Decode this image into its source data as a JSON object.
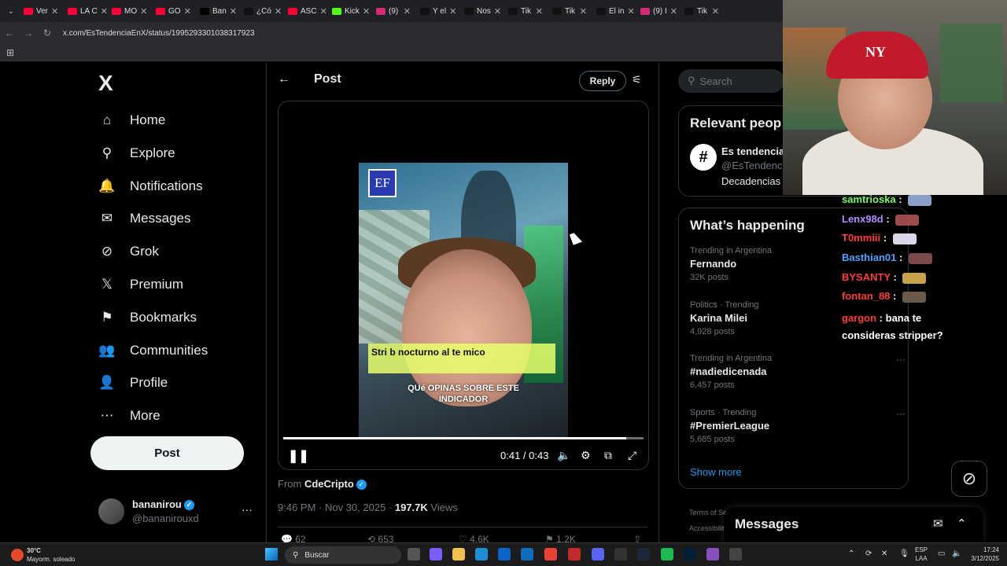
{
  "browser": {
    "tabs": [
      {
        "label": "Ver",
        "color": "#ff0033"
      },
      {
        "label": "LA C",
        "color": "#ff0033"
      },
      {
        "label": "MO",
        "color": "#ff0033"
      },
      {
        "label": "GO",
        "color": "#ff0033"
      },
      {
        "label": "Ban",
        "color": "#000000"
      },
      {
        "label": "¿Có",
        "color": "#111111"
      },
      {
        "label": "ASC",
        "color": "#ff0033"
      },
      {
        "label": "Kick",
        "color": "#53fc18"
      },
      {
        "label": "(9)",
        "color": "#d62976"
      },
      {
        "label": "Y el",
        "color": "#111111"
      },
      {
        "label": "Nos",
        "color": "#111111"
      },
      {
        "label": "Tik",
        "color": "#111111"
      },
      {
        "label": "Tik",
        "color": "#111111"
      },
      {
        "label": "El in",
        "color": "#111111"
      },
      {
        "label": "(9) I",
        "color": "#d62976"
      },
      {
        "label": "Tik",
        "color": "#111111"
      }
    ],
    "url": "x.com/EsTendenciaEnX/status/1995293301038317923"
  },
  "nav": {
    "logo": "X",
    "items": [
      {
        "label": "Home",
        "icon": "home-icon",
        "glyph": "⌂"
      },
      {
        "label": "Explore",
        "icon": "search-icon",
        "glyph": "⚲"
      },
      {
        "label": "Notifications",
        "icon": "bell-icon",
        "glyph": "🔔"
      },
      {
        "label": "Messages",
        "icon": "envelope-icon",
        "glyph": "✉"
      },
      {
        "label": "Grok",
        "icon": "grok-icon",
        "glyph": "⊘"
      },
      {
        "label": "Premium",
        "icon": "x-logo-icon",
        "glyph": "𝕏"
      },
      {
        "label": "Bookmarks",
        "icon": "bookmark-icon",
        "glyph": "⚑"
      },
      {
        "label": "Communities",
        "icon": "people-icon",
        "glyph": "👥"
      },
      {
        "label": "Profile",
        "icon": "person-icon",
        "glyph": "👤"
      },
      {
        "label": "More",
        "icon": "more-circle-icon",
        "glyph": "⋯"
      }
    ],
    "post_button": "Post",
    "account": {
      "name": "bananirou",
      "handle": "@bananirouxd"
    }
  },
  "post": {
    "header_title": "Post",
    "reply_label": "Reply",
    "video": {
      "logo_text": "EF",
      "band_text": "Stri      b nocturno al te         mico",
      "caption": "QUé OPINAS SOBRE ESTE INDICADOR",
      "time": "0:41 / 0:43",
      "progress": 0.953
    },
    "from_label": "From",
    "from_name": "CdeCripto",
    "timestamp": "9:46 PM · Nov 30, 2025 · ",
    "views_count": "197.7K",
    "views_label": "Views",
    "actions": [
      "62",
      "653",
      "4.6K",
      "1.2K"
    ]
  },
  "right": {
    "search_placeholder": "Search",
    "relevant_title": "Relevant peop",
    "relevant": {
      "name": "Es tendencia",
      "handle": "@EsTendenci",
      "bio": "Decadencias"
    },
    "happening_title": "What’s happening",
    "trends": [
      {
        "category": "Trending in Argentina",
        "name": "Fernando",
        "posts": "32K posts"
      },
      {
        "category": "Politics · Trending",
        "name": "Karina Milei",
        "posts": "4,928 posts"
      },
      {
        "category": "Trending in Argentina",
        "name": "#nadiedicenada",
        "posts": "6,457 posts"
      },
      {
        "category": "Sports · Trending",
        "name": "#PremierLeague",
        "posts": "5,685 posts"
      }
    ],
    "show_more": "Show more",
    "footer_1": "Terms of Service  |  Privacy Policy  |  Cookie Policy  |",
    "footer_2": "Accessibility"
  },
  "messages_dock": {
    "title": "Messages"
  },
  "stream": {
    "chat": [
      {
        "user": "samtrioska",
        "color": "#7cff6b",
        "message": ""
      },
      {
        "user": "Lenx98d",
        "color": "#b58cff",
        "message": ""
      },
      {
        "user": "T0mmiii",
        "color": "#ff3b3b",
        "message": ""
      },
      {
        "user": "Basthian01",
        "color": "#4aa3ff",
        "message": ""
      },
      {
        "user": "BYSANTY",
        "color": "#ff3b3b",
        "message": ""
      },
      {
        "user": "fontan_88",
        "color": "#ff3b3b",
        "message": ""
      },
      {
        "user": "gargon",
        "color": "#ff3b3b",
        "message": "bana te consideras stripper?"
      }
    ],
    "cap_logo": "NY"
  },
  "taskbar": {
    "temp": "30°C",
    "condition": "Mayorm. soleado",
    "search": "Buscar",
    "lang_1": "ESP",
    "lang_2": "LAA",
    "time": "17:24",
    "date": "3/12/2025"
  }
}
